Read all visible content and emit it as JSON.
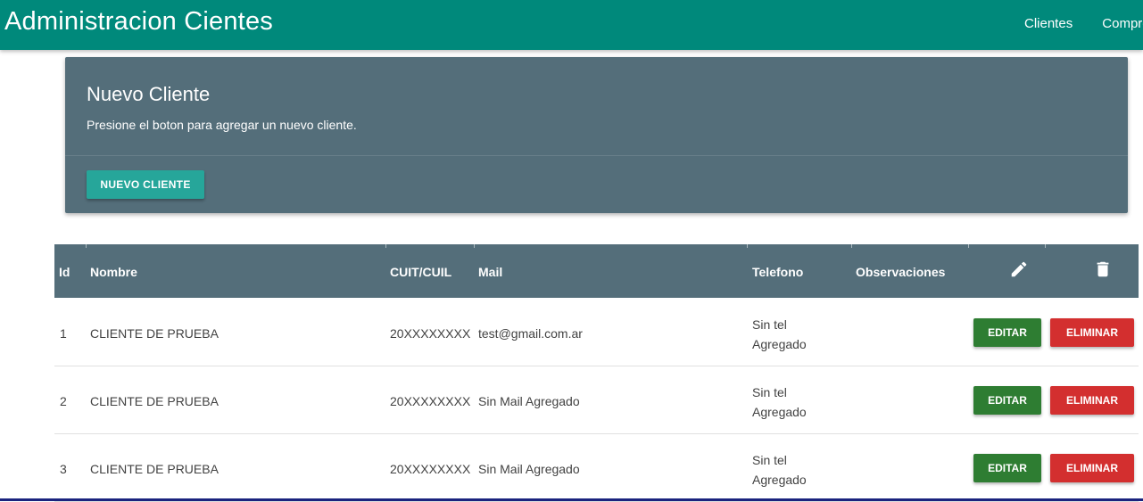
{
  "navbar": {
    "brand": "Administracion Cientes",
    "links": [
      "Clientes",
      "Compro"
    ]
  },
  "card": {
    "title": "Nuevo Cliente",
    "text": "Presione el boton para agregar un nuevo cliente.",
    "button_label": "NUEVO CLIENTE"
  },
  "table": {
    "headers": {
      "id": "Id",
      "nombre": "Nombre",
      "cuit": "CUIT/CUIL",
      "mail": "Mail",
      "telefono": "Telefono",
      "observaciones": "Observaciones",
      "edit_icon": "pencil-icon",
      "delete_icon": "trash-icon"
    },
    "rows": [
      {
        "id": "1",
        "nombre": "CLIENTE DE PRUEBA",
        "cuit": "20XXXXXXXX",
        "mail": "test@gmail.com.ar",
        "tel_line1": "Sin tel",
        "tel_line2": "Agregado",
        "observaciones": "",
        "edit_label": "EDITAR",
        "delete_label": "ELIMINAR"
      },
      {
        "id": "2",
        "nombre": "CLIENTE DE PRUEBA",
        "cuit": "20XXXXXXXX",
        "mail": "Sin Mail Agregado",
        "tel_line1": "Sin tel",
        "tel_line2": "Agregado",
        "observaciones": "",
        "edit_label": "EDITAR",
        "delete_label": "ELIMINAR"
      },
      {
        "id": "3",
        "nombre": "CLIENTE DE PRUEBA",
        "cuit": "20XXXXXXXX",
        "mail": "Sin Mail Agregado",
        "tel_line1": "Sin tel",
        "tel_line2": "Agregado",
        "observaciones": "",
        "edit_label": "EDITAR",
        "delete_label": "ELIMINAR"
      }
    ]
  },
  "colors": {
    "navbar": "#00897b",
    "card": "#546e7a",
    "accent_button": "#26a69a",
    "edit_button": "#2e7d32",
    "delete_button": "#d32f2f"
  }
}
